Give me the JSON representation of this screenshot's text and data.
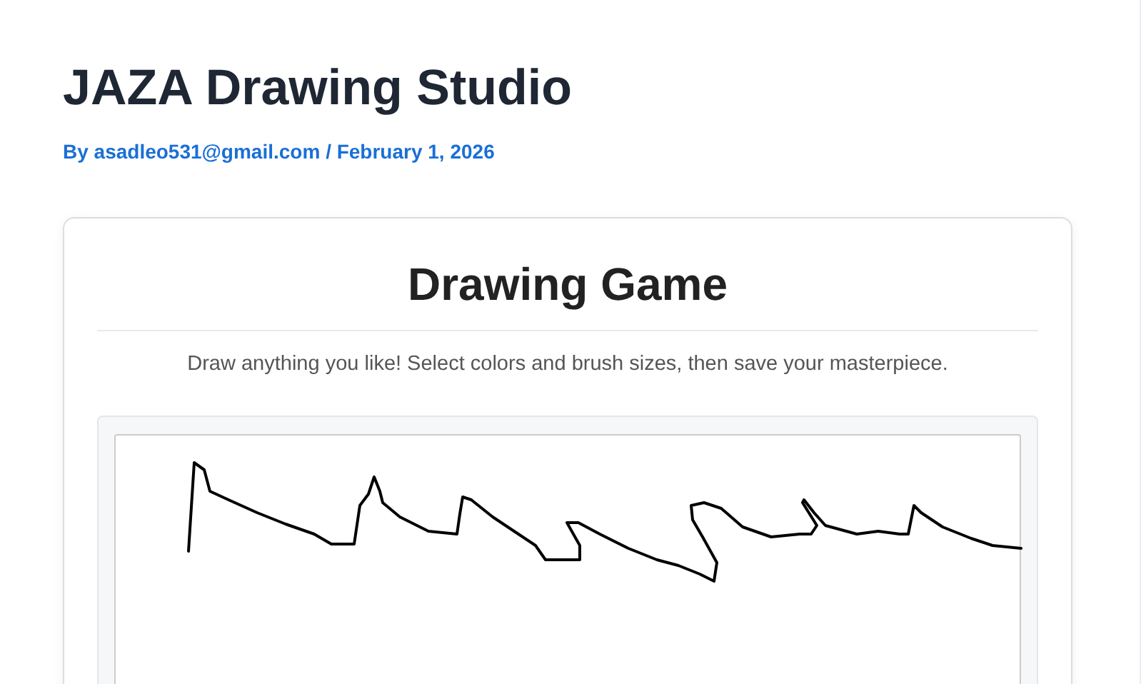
{
  "page": {
    "title": "JAZA Drawing Studio",
    "byline": "By asadleo531@gmail.com / February 1, 2026"
  },
  "card": {
    "heading": "Drawing Game",
    "description": "Draw anything you like! Select colors and brush sizes, then save your masterpiece."
  }
}
